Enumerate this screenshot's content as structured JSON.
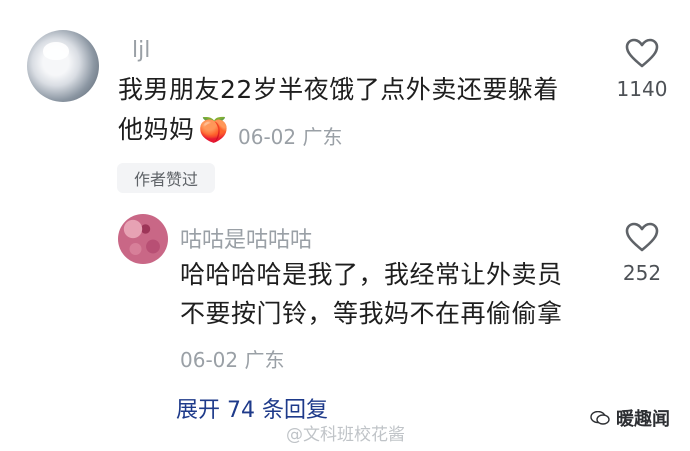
{
  "comment": {
    "username": "ljl",
    "text_line1": "我男朋友22岁半夜饿了点外卖还要躲着",
    "text_line2": "他妈妈",
    "meta": "06-02 广东",
    "badge": "作者赞过",
    "likes": "1140",
    "emoji": "🍑"
  },
  "reply": {
    "username": "咕咕是咕咕咕",
    "text_line1": "哈哈哈哈是我了，我经常让外卖员",
    "text_line2": "不要按门铃，等我妈不在再偷偷拿",
    "meta": "06-02 广东",
    "likes": "252"
  },
  "expand_label": "展开 74 条回复",
  "watermark_left": "@文科班校花酱",
  "watermark_right": "暖趣闻",
  "colors": {
    "link": "#1e3a8a",
    "gray": "#9aa0a6",
    "text": "#1e1e1e"
  }
}
